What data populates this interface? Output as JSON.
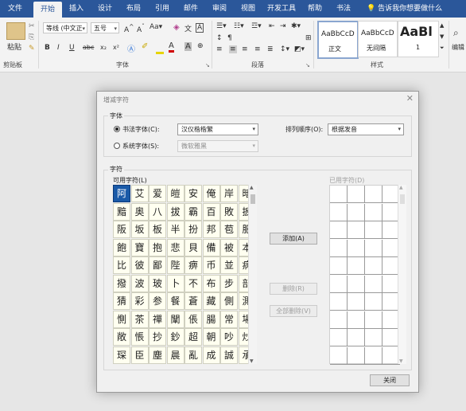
{
  "ribbon_tabs": [
    "文件",
    "开始",
    "插入",
    "设计",
    "布局",
    "引用",
    "邮件",
    "审阅",
    "视图",
    "开发工具",
    "帮助",
    "书法"
  ],
  "search_tab": "告诉我你想要做什么",
  "ribbon": {
    "paste_label": "粘贴",
    "clipboard_label": "剪贴板",
    "font_name": "等线 (中文正",
    "font_size": "五号",
    "font_group_label": "字体",
    "paragraph_group_label": "段落",
    "styles_group_label": "样式",
    "edit_label": "编辑",
    "styles": [
      {
        "preview": "AaBbCcD",
        "name": "正文"
      },
      {
        "preview": "AaBbCcD",
        "name": "无间隔"
      },
      {
        "preview": "AaBl",
        "name": "1"
      }
    ],
    "font_buttons": [
      "B",
      "I",
      "U",
      "abc",
      "x₂",
      "x²"
    ]
  },
  "dialog": {
    "title": "增减字符",
    "close_glyph": "✕",
    "font_frame_label": "字体",
    "calligraphy_label": "书法字体(C):",
    "calligraphy_value": "汉仪楷楷繁",
    "system_label": "系统字体(S):",
    "system_value": "微软雅黑",
    "order_label": "排列顺序(O):",
    "order_value": "根据发音",
    "chars_frame_label": "字符",
    "available_label": "可用字符(L)",
    "used_label": "已用字符(D)",
    "add_button": "添加(A)",
    "delete_button": "删除(R)",
    "delete_all_button": "全部删除(V)",
    "close_button": "关闭",
    "available_chars": [
      [
        "阿",
        "艾",
        "爱",
        "皚",
        "安",
        "俺",
        "岸",
        "暗"
      ],
      [
        "黯",
        "奥",
        "八",
        "拔",
        "霸",
        "百",
        "敗",
        "扳"
      ],
      [
        "阪",
        "坂",
        "板",
        "半",
        "扮",
        "邦",
        "苞",
        "肥"
      ],
      [
        "飽",
        "寶",
        "抱",
        "悲",
        "貝",
        "備",
        "被",
        "本"
      ],
      [
        "比",
        "彼",
        "鄙",
        "陛",
        "痹",
        "币",
        "並",
        "病"
      ],
      [
        "撥",
        "波",
        "玻",
        "卜",
        "不",
        "布",
        "步",
        "部"
      ],
      [
        "猜",
        "彩",
        "参",
        "餐",
        "蒼",
        "藏",
        "側",
        "測"
      ],
      [
        "惻",
        "茶",
        "禪",
        "闡",
        "倀",
        "腸",
        "常",
        "場"
      ],
      [
        "敞",
        "悵",
        "抄",
        "鈔",
        "超",
        "朝",
        "吵",
        "炒"
      ],
      [
        "琛",
        "臣",
        "塵",
        "晨",
        "亂",
        "成",
        "誠",
        "承"
      ]
    ]
  }
}
